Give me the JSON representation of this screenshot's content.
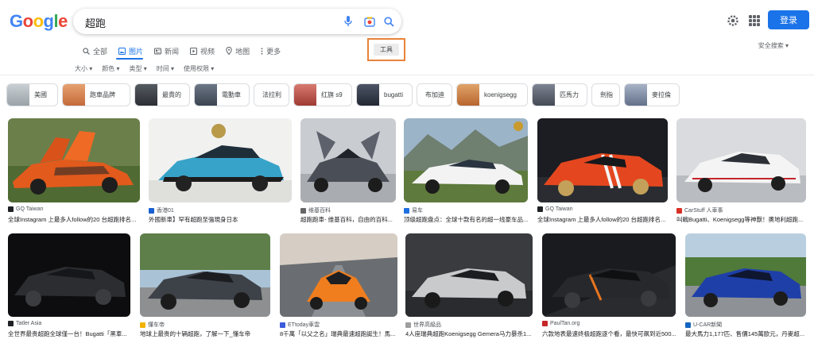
{
  "header": {
    "logo": [
      "G",
      "o",
      "o",
      "g",
      "l",
      "e"
    ],
    "logo_colors": [
      "#4285F4",
      "#EA4335",
      "#FBBC05",
      "#4285F4",
      "#34A853",
      "#EA4335"
    ],
    "query": "超跑",
    "login_label": "登录"
  },
  "tabs": [
    {
      "label": "全部",
      "icon": "search-icon"
    },
    {
      "label": "图片",
      "icon": "image-icon",
      "active": true
    },
    {
      "label": "新闻",
      "icon": "news-icon"
    },
    {
      "label": "视频",
      "icon": "play-icon"
    },
    {
      "label": "地图",
      "icon": "location-pin-icon"
    },
    {
      "label": "更多",
      "icon": "more-vertical-icon"
    }
  ],
  "tools_label": "工具",
  "safe_search": "安全搜索 ▾",
  "filters": [
    "大小 ▾",
    "颜色 ▾",
    "类型 ▾",
    "时间 ▾",
    "使用权限 ▾"
  ],
  "chips": [
    {
      "label": "美國",
      "thumb": "#9aa3a8"
    },
    {
      "label": "跑車品牌",
      "thumb": "#c46a3a"
    },
    {
      "label": "最貴的",
      "thumb": "#3b3f45"
    },
    {
      "label": "電動車",
      "thumb": "#4a5563"
    },
    {
      "label": "法拉利"
    },
    {
      "label": "红旗 s9",
      "thumb": "#b0453f"
    },
    {
      "label": "bugatti",
      "thumb": "#2f3440"
    },
    {
      "label": "布加迪"
    },
    {
      "label": "koenigsegg",
      "thumb": "#c97a3c"
    },
    {
      "label": "匹馬力",
      "thumb": "#555b66"
    },
    {
      "label": "劍指"
    },
    {
      "label": "麥拉倫",
      "thumb": "#7f8aa0"
    }
  ],
  "results": [
    {
      "source": "GQ Taiwan",
      "caption": "全球Instagram 上最多人follow的20 台超跑排名...",
      "fav": "#202124"
    },
    {
      "source": "香港01",
      "caption": "外國新車】罕有超跑至強現身日本",
      "fav": "#1a5fd1"
    },
    {
      "source": "维基百科",
      "caption": "超跑跑車- 维基百科，自由的百科...",
      "fav": "#666666"
    },
    {
      "source": "易车",
      "caption": "顶级超跑盘点：全球十款有名的超一线豪车品...",
      "fav": "#1f6fe0"
    },
    {
      "source": "GQ Taiwan",
      "caption": "全球Instagram 上最多人follow的20 台超跑排名...",
      "fav": "#202124"
    },
    {
      "source": "CarStuff 人車事",
      "caption": "叫戰Bugatti、Koenigsegg等神獸！奧地利超跑...",
      "fav": "#d93025"
    },
    {
      "source": "Tatler Asia",
      "caption": "全世界最贵超跑全球僅一台！Bugatti「黑車...",
      "fav": "#202124"
    },
    {
      "source": "懂车帝",
      "caption": "地球上最贵的十辆超跑，了解一下_懂车帝",
      "fav": "#f2b400"
    },
    {
      "source": "ETtoday車雲",
      "caption": "8千萬「以父之名」瑞典最速超跑誕生！馬...",
      "fav": "#3b5bdb"
    },
    {
      "source": "世界高級品",
      "caption": "4人座瑞典超跑Koenigsegg Gemera马力暴杀1...",
      "fav": "#9e9e9e"
    },
    {
      "source": "PaulTan.org",
      "caption": "六款地表最速终极超跑逐个看，最快可飙到近500...",
      "fav": "#c62828"
    },
    {
      "source": "U-CAR新聞",
      "caption": "最大馬力1,177匹、售價145萬歐元，丹麥超...",
      "fav": "#1565c0"
    }
  ]
}
